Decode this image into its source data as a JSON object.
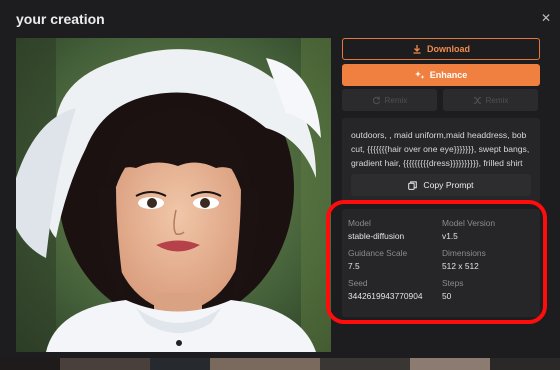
{
  "modal": {
    "title": "your creation",
    "close_icon": "close-icon"
  },
  "actions": {
    "download_label": "Download",
    "download_icon": "download-icon",
    "enhance_label": "Enhance",
    "enhance_icon": "sparkle-icon",
    "remix_label": "Remix",
    "remix2_label": "Remix"
  },
  "prompt": {
    "text": "outdoors, , maid uniform,maid headdress, bob cut, {{{{{{{hair over one eye}}}}}}}, swept bangs, gradient hair, {{{{{{{{{dress}}}}}}}}}}, frilled shirt",
    "copy_label": "Copy Prompt",
    "copy_icon": "copy-icon"
  },
  "metadata": {
    "model_label": "Model",
    "model_value": "stable-diffusion",
    "version_label": "Model Version",
    "version_value": "v1.5",
    "guidance_label": "Guidance Scale",
    "guidance_value": "7.5",
    "dimensions_label": "Dimensions",
    "dimensions_value": "512 x 512",
    "seed_label": "Seed",
    "seed_value": "3442619943770904",
    "steps_label": "Steps",
    "steps_value": "50"
  },
  "colors": {
    "accent": "#ef8040",
    "highlight": "#ff0d0d",
    "modal_bg": "#1d1d1f",
    "panel_bg": "#262629"
  }
}
